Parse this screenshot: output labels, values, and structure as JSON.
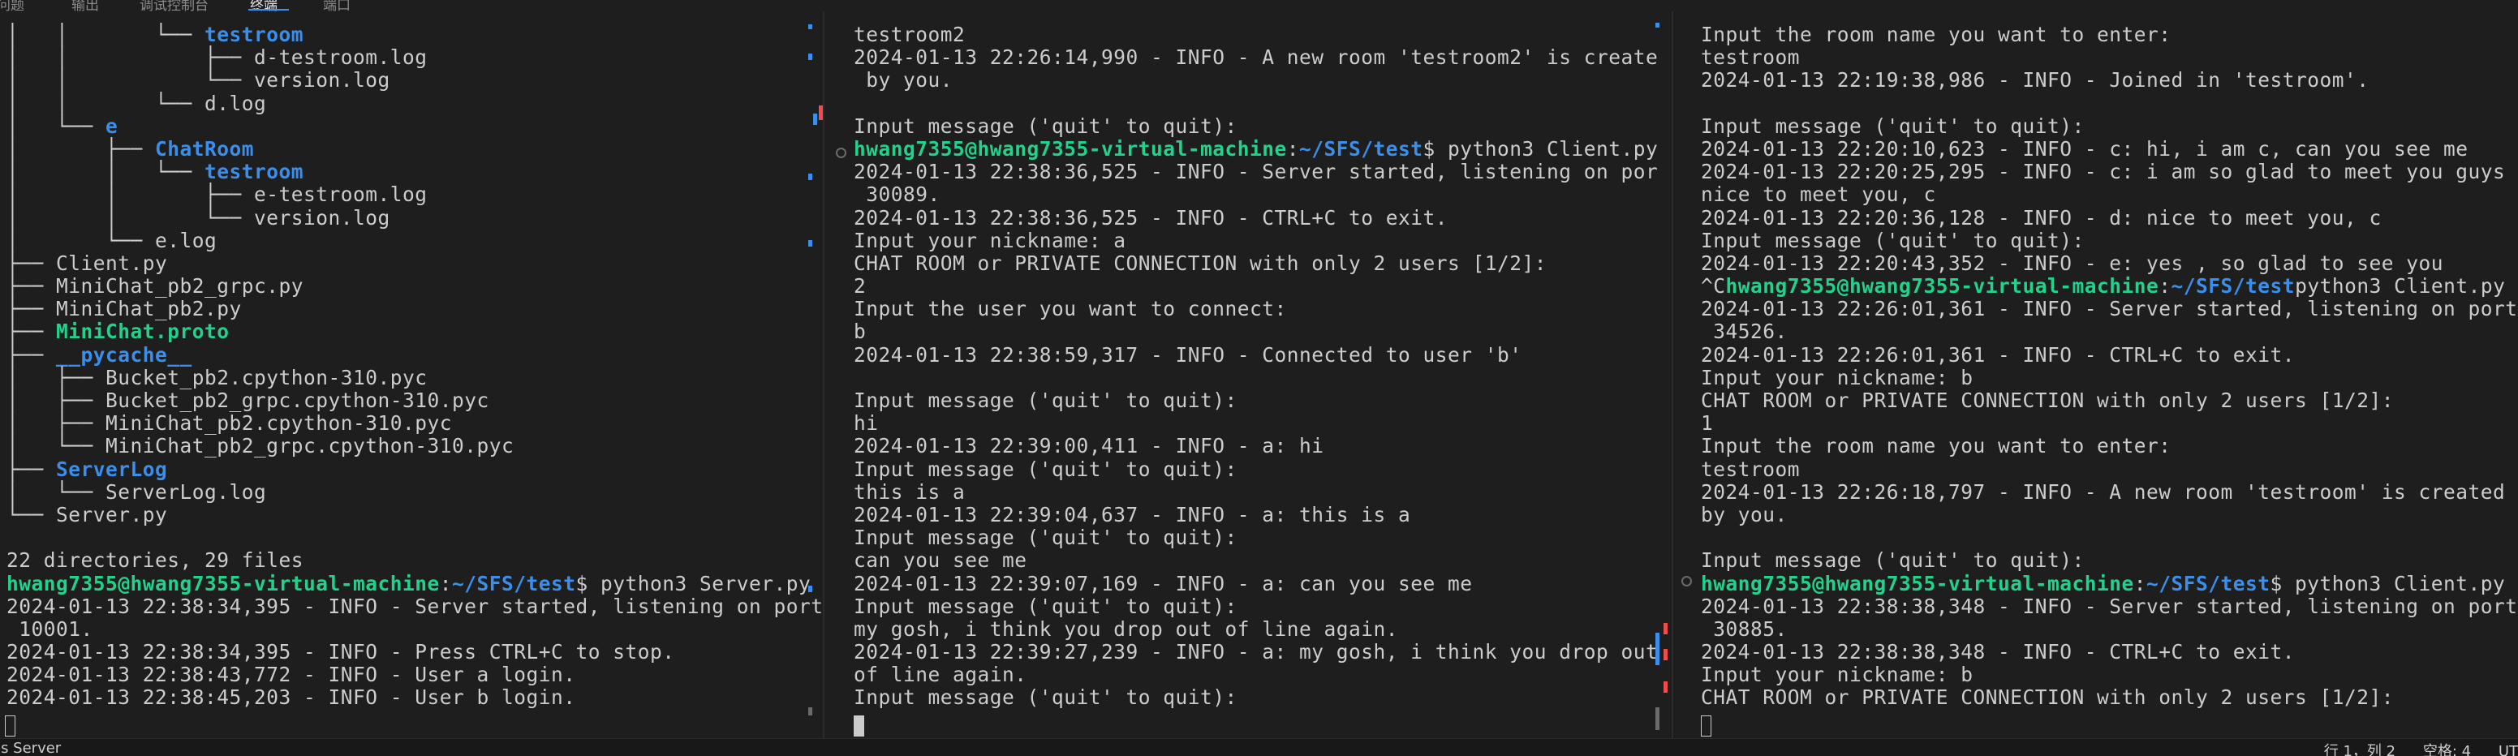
{
  "top_tabs": [
    {
      "label": "问题",
      "active": false
    },
    {
      "label": "输出",
      "active": false
    },
    {
      "label": "调试控制台",
      "active": false
    },
    {
      "label": "终端",
      "active": true
    },
    {
      "label": "端口",
      "active": false
    }
  ],
  "pane_left": {
    "lines": [
      [
        {
          "t": "│   │       └── "
        },
        {
          "t": "testroom",
          "c": "dir"
        }
      ],
      [
        {
          "t": "│   │           ├── d-testroom.log"
        }
      ],
      [
        {
          "t": "│   │           └── version.log"
        }
      ],
      [
        {
          "t": "│   │       └── d.log"
        }
      ],
      [
        {
          "t": "│   └── "
        },
        {
          "t": "e",
          "c": "dir"
        }
      ],
      [
        {
          "t": "│       ├── "
        },
        {
          "t": "ChatRoom",
          "c": "dir"
        }
      ],
      [
        {
          "t": "│       │   └── "
        },
        {
          "t": "testroom",
          "c": "dir"
        }
      ],
      [
        {
          "t": "│       │       ├── e-testroom.log"
        }
      ],
      [
        {
          "t": "│       │       └── version.log"
        }
      ],
      [
        {
          "t": "│       └── e.log"
        }
      ],
      [
        {
          "t": "├── Client.py"
        }
      ],
      [
        {
          "t": "├── MiniChat_pb2_grpc.py"
        }
      ],
      [
        {
          "t": "├── MiniChat_pb2.py"
        }
      ],
      [
        {
          "t": "├── "
        },
        {
          "t": "MiniChat.proto",
          "c": "green"
        }
      ],
      [
        {
          "t": "├── "
        },
        {
          "t": "__pycache__",
          "c": "dir"
        }
      ],
      [
        {
          "t": "│   ├── Bucket_pb2.cpython-310.pyc"
        }
      ],
      [
        {
          "t": "│   ├── Bucket_pb2_grpc.cpython-310.pyc"
        }
      ],
      [
        {
          "t": "│   ├── MiniChat_pb2.cpython-310.pyc"
        }
      ],
      [
        {
          "t": "│   └── MiniChat_pb2_grpc.cpython-310.pyc"
        }
      ],
      [
        {
          "t": "├── "
        },
        {
          "t": "ServerLog",
          "c": "dir"
        }
      ],
      [
        {
          "t": "│   └── ServerLog.log"
        }
      ],
      [
        {
          "t": "└── Server.py"
        }
      ],
      [
        {
          "t": ""
        }
      ],
      [
        {
          "t": "22 directories, 29 files"
        }
      ],
      [
        {
          "t": "hwang7355@hwang7355-virtual-machine",
          "c": "prompt-user"
        },
        {
          "t": ":"
        },
        {
          "t": "~/SFS/test",
          "c": "prompt-path"
        },
        {
          "t": "$ python3 Server.py"
        }
      ],
      [
        {
          "t": "2024-01-13 22:38:34,395 - INFO - Server started, listening on port"
        }
      ],
      [
        {
          "t": " 10001."
        }
      ],
      [
        {
          "t": "2024-01-13 22:38:34,395 - INFO - Press CTRL+C to stop."
        }
      ],
      [
        {
          "t": "2024-01-13 22:38:43,772 - INFO - User a login."
        }
      ],
      [
        {
          "t": "2024-01-13 22:38:45,203 - INFO - User b login."
        }
      ]
    ]
  },
  "pane_middle": {
    "lines": [
      [
        {
          "t": "testroom2"
        }
      ],
      [
        {
          "t": "2024-01-13 22:26:14,990 - INFO - A new room 'testroom2' is created"
        }
      ],
      [
        {
          "t": " by you."
        }
      ],
      [
        {
          "t": ""
        }
      ],
      [
        {
          "t": "Input message ('quit' to quit):"
        }
      ],
      [
        {
          "t": "hwang7355@hwang7355-virtual-machine",
          "c": "prompt-user"
        },
        {
          "t": ":"
        },
        {
          "t": "~/SFS/test",
          "c": "prompt-path"
        },
        {
          "t": "$ python3 Client.py"
        }
      ],
      [
        {
          "t": "2024-01-13 22:38:36,525 - INFO - Server started, listening on port"
        }
      ],
      [
        {
          "t": " 30089."
        }
      ],
      [
        {
          "t": "2024-01-13 22:38:36,525 - INFO - CTRL+C to exit."
        }
      ],
      [
        {
          "t": "Input your nickname: a"
        }
      ],
      [
        {
          "t": "CHAT ROOM or PRIVATE CONNECTION with only 2 users [1/2]:"
        }
      ],
      [
        {
          "t": "2"
        }
      ],
      [
        {
          "t": "Input the user you want to connect:"
        }
      ],
      [
        {
          "t": "b"
        }
      ],
      [
        {
          "t": "2024-01-13 22:38:59,317 - INFO - Connected to user 'b'"
        }
      ],
      [
        {
          "t": ""
        }
      ],
      [
        {
          "t": "Input message ('quit' to quit):"
        }
      ],
      [
        {
          "t": "hi"
        }
      ],
      [
        {
          "t": "2024-01-13 22:39:00,411 - INFO - a: hi"
        }
      ],
      [
        {
          "t": "Input message ('quit' to quit):"
        }
      ],
      [
        {
          "t": "this is a"
        }
      ],
      [
        {
          "t": "2024-01-13 22:39:04,637 - INFO - a: this is a"
        }
      ],
      [
        {
          "t": "Input message ('quit' to quit):"
        }
      ],
      [
        {
          "t": "can you see me"
        }
      ],
      [
        {
          "t": "2024-01-13 22:39:07,169 - INFO - a: can you see me"
        }
      ],
      [
        {
          "t": "Input message ('quit' to quit):"
        }
      ],
      [
        {
          "t": "my gosh, i think you drop out of line again."
        }
      ],
      [
        {
          "t": "2024-01-13 22:39:27,239 - INFO - a: my gosh, i think you drop out"
        }
      ],
      [
        {
          "t": "of line again."
        }
      ],
      [
        {
          "t": "Input message ('quit' to quit):"
        }
      ]
    ]
  },
  "pane_right": {
    "lines": [
      [
        {
          "t": "Input the room name you want to enter:"
        }
      ],
      [
        {
          "t": "testroom"
        }
      ],
      [
        {
          "t": "2024-01-13 22:19:38,986 - INFO - Joined in 'testroom'."
        }
      ],
      [
        {
          "t": ""
        }
      ],
      [
        {
          "t": "Input message ('quit' to quit):"
        }
      ],
      [
        {
          "t": "2024-01-13 22:20:10,623 - INFO - c: hi, i am c, can you see me"
        }
      ],
      [
        {
          "t": "2024-01-13 22:20:25,295 - INFO - c: i am so glad to meet you guys"
        }
      ],
      [
        {
          "t": "nice to meet you, c"
        }
      ],
      [
        {
          "t": "2024-01-13 22:20:36,128 - INFO - d: nice to meet you, c"
        }
      ],
      [
        {
          "t": "Input message ('quit' to quit):"
        }
      ],
      [
        {
          "t": "2024-01-13 22:20:43,352 - INFO - e: yes , so glad to see you"
        }
      ],
      [
        {
          "t": "^C"
        },
        {
          "t": "hwang7355@hwang7355-virtual-machine",
          "c": "prompt-user"
        },
        {
          "t": ":"
        },
        {
          "t": "~/SFS/test",
          "c": "prompt-path"
        },
        {
          "t": "python3 Client.py"
        }
      ],
      [
        {
          "t": "2024-01-13 22:26:01,361 - INFO - Server started, listening on port"
        }
      ],
      [
        {
          "t": " 34526."
        }
      ],
      [
        {
          "t": "2024-01-13 22:26:01,361 - INFO - CTRL+C to exit."
        }
      ],
      [
        {
          "t": "Input your nickname: b"
        }
      ],
      [
        {
          "t": "CHAT ROOM or PRIVATE CONNECTION with only 2 users [1/2]:"
        }
      ],
      [
        {
          "t": "1"
        }
      ],
      [
        {
          "t": "Input the room name you want to enter:"
        }
      ],
      [
        {
          "t": "testroom"
        }
      ],
      [
        {
          "t": "2024-01-13 22:26:18,797 - INFO - A new room 'testroom' is created"
        }
      ],
      [
        {
          "t": "by you."
        }
      ],
      [
        {
          "t": ""
        }
      ],
      [
        {
          "t": "Input message ('quit' to quit):"
        }
      ],
      [
        {
          "t": "hwang7355@hwang7355-virtual-machine",
          "c": "prompt-user"
        },
        {
          "t": ":"
        },
        {
          "t": "~/SFS/test",
          "c": "prompt-path"
        },
        {
          "t": "$ python3 Client.py"
        }
      ],
      [
        {
          "t": "2024-01-13 22:38:38,348 - INFO - Server started, listening on port"
        }
      ],
      [
        {
          "t": " 30885."
        }
      ],
      [
        {
          "t": "2024-01-13 22:38:38,348 - INFO - CTRL+C to exit."
        }
      ],
      [
        {
          "t": "Input your nickname: b"
        }
      ],
      [
        {
          "t": "CHAT ROOM or PRIVATE CONNECTION with only 2 users [1/2]:"
        }
      ]
    ]
  },
  "status_bar": {
    "left": "es Server",
    "position": "行 1，列 2",
    "spaces": "空格: 4",
    "encoding": "UT"
  },
  "colors": {
    "background": "#1e1e1e",
    "text": "#cccccc",
    "directory": "#3b8eea",
    "prompt_user": "#23d18b",
    "accent": "#3794ff"
  }
}
